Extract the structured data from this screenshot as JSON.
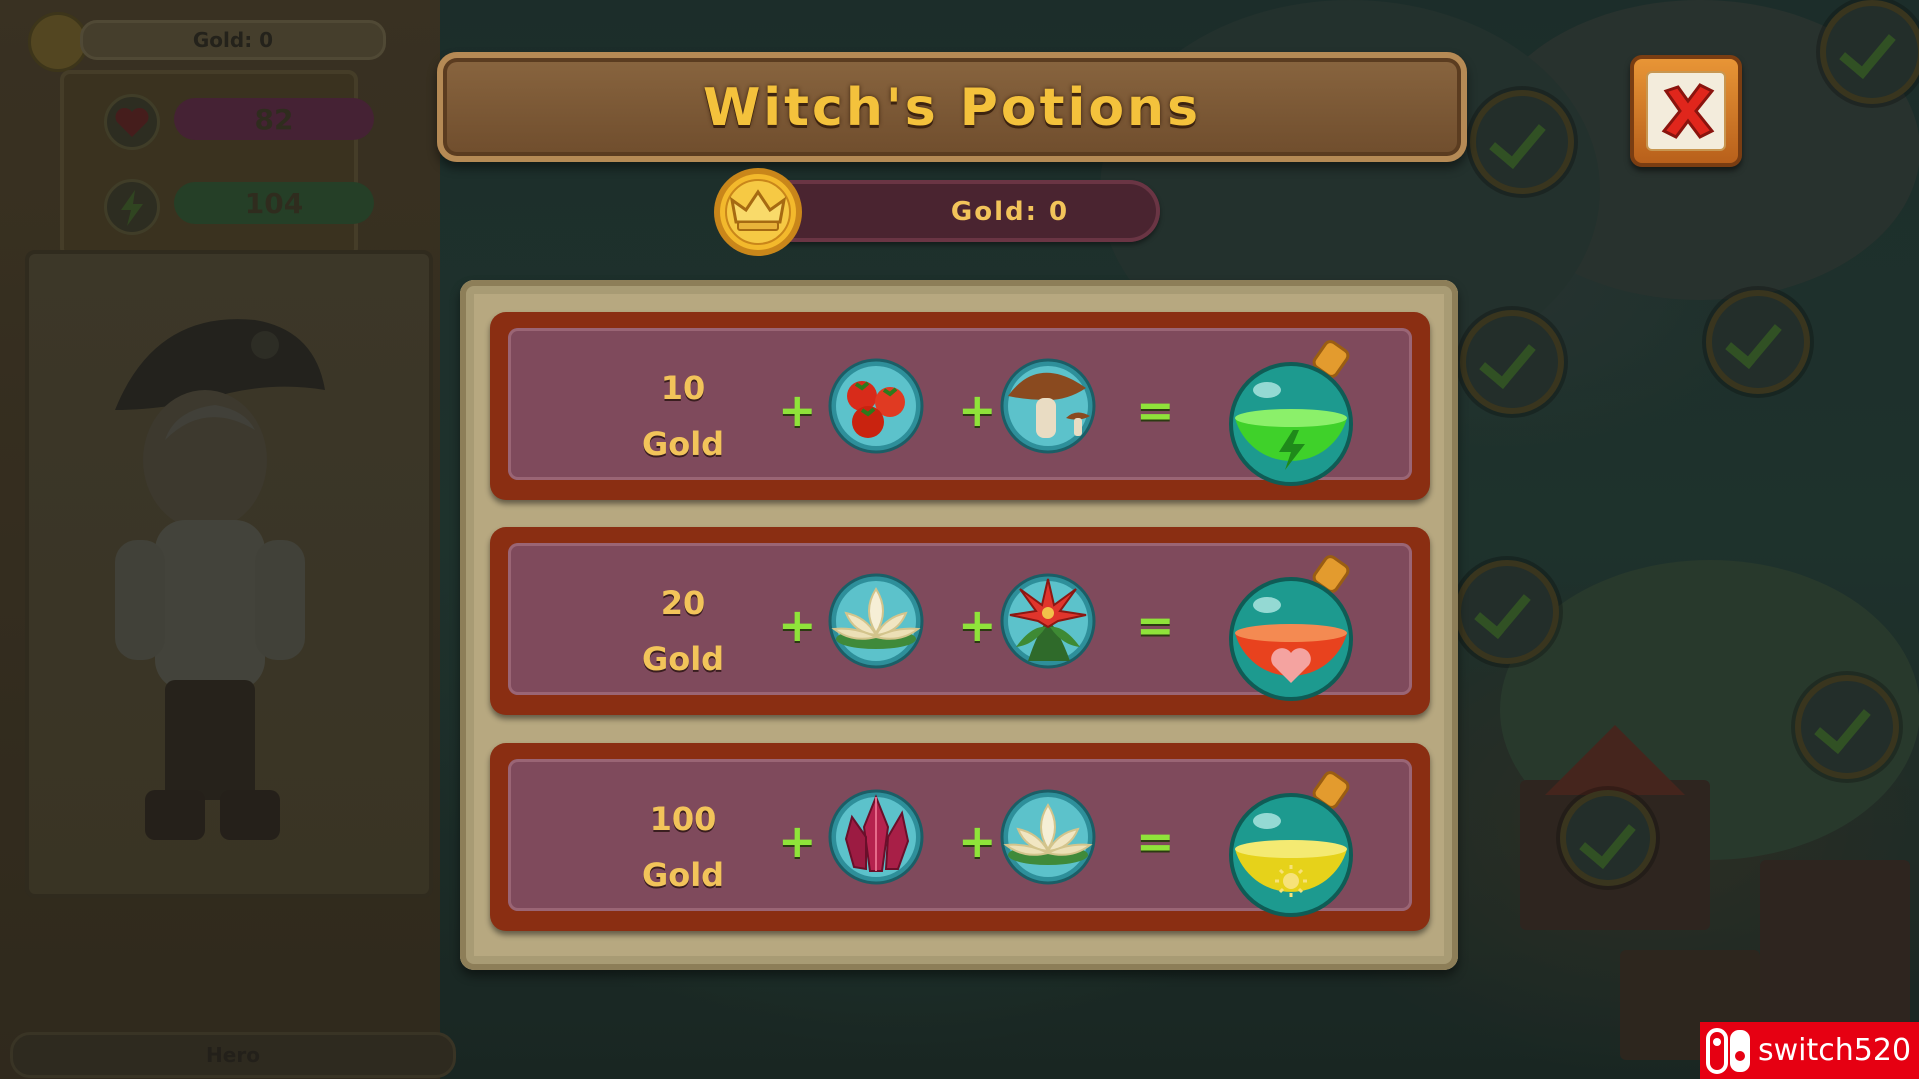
{
  "sidebar": {
    "gold_label": "Gold: 0",
    "health_value": "82",
    "energy_value": "104",
    "hero_label": "Hero"
  },
  "dialog": {
    "title": "Witch's Potions",
    "gold_label": "Gold: 0",
    "close_icon": "close-x-icon"
  },
  "recipes": [
    {
      "price_amount": "10",
      "price_unit": "Gold",
      "plus": "+",
      "equals": "=",
      "ingredient_1": "tomatoes-icon",
      "ingredient_2": "mushroom-icon",
      "result": "energy-potion-icon",
      "potion_color": "#3fd12a"
    },
    {
      "price_amount": "20",
      "price_unit": "Gold",
      "plus": "+",
      "equals": "=",
      "ingredient_1": "lotus-icon",
      "ingredient_2": "red-flower-icon",
      "result": "health-potion-icon",
      "potion_color": "#e8421e"
    },
    {
      "price_amount": "100",
      "price_unit": "Gold",
      "plus": "+",
      "equals": "=",
      "ingredient_1": "crystal-icon",
      "ingredient_2": "lotus-icon",
      "result": "sun-potion-icon",
      "potion_color": "#e6d21a"
    }
  ],
  "watermark": {
    "text": "switch520"
  },
  "colors": {
    "title_gold": "#f4c23c",
    "plus_green": "#8fe33a",
    "row_frame": "#8a2e12",
    "row_fill": "#7f4a5c"
  }
}
